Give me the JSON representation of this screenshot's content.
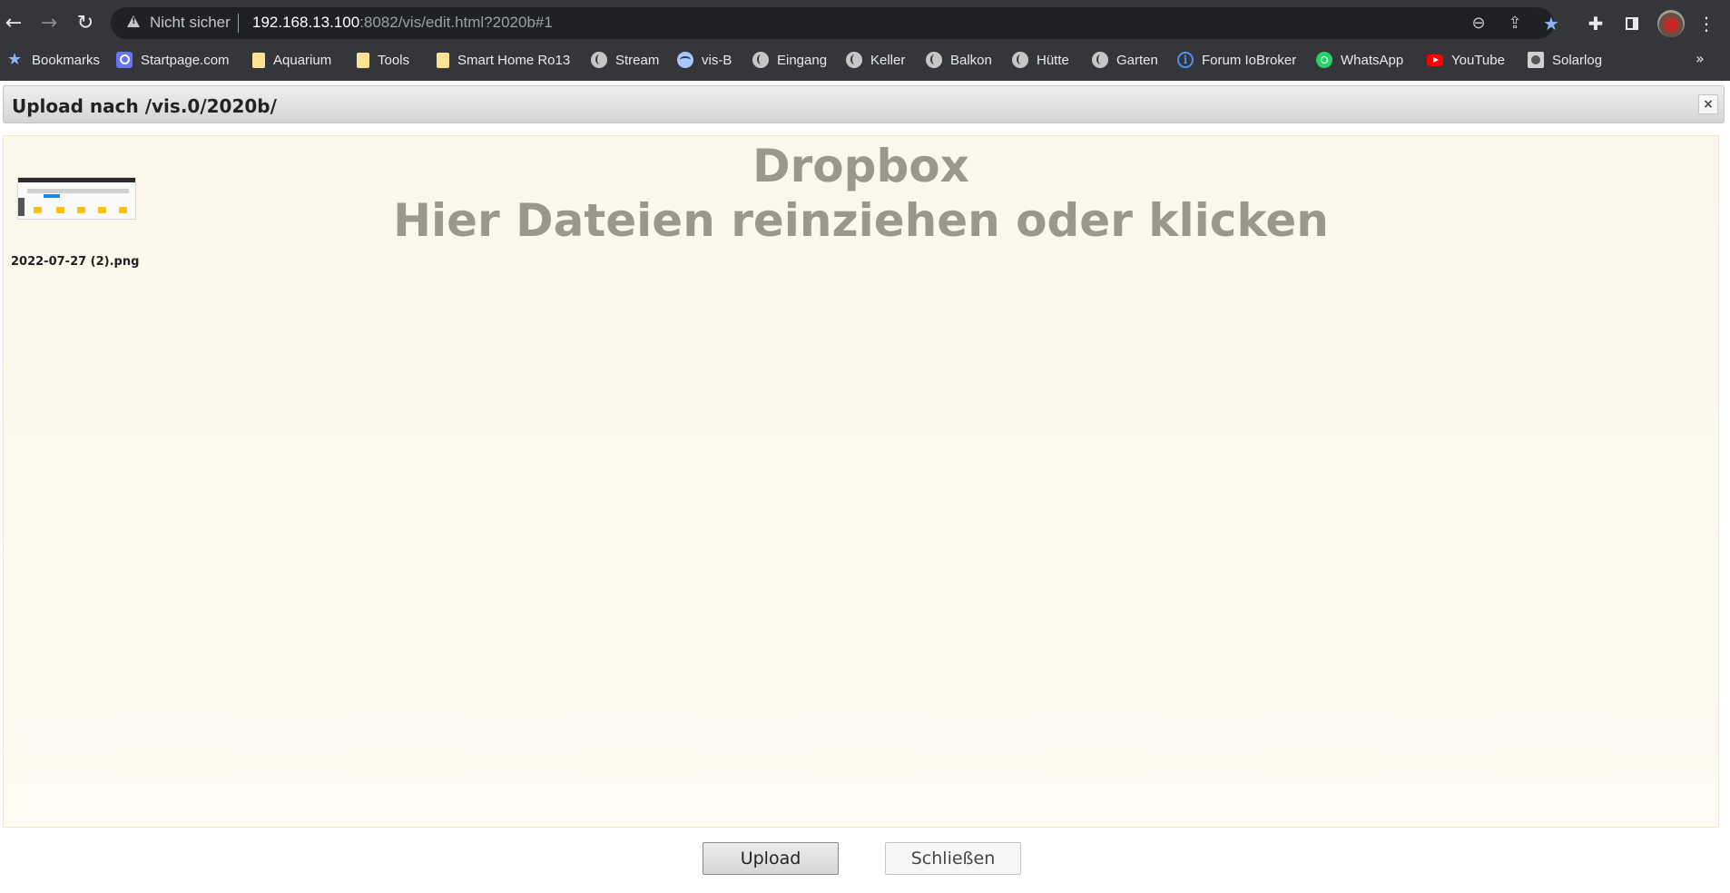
{
  "browser": {
    "security_label": "Nicht sicher",
    "url_host": "192.168.13.100",
    "url_rest": ":8082/vis/edit.html?2020b#1"
  },
  "bookmarks": [
    {
      "label": "Bookmarks",
      "icon": "star-icon"
    },
    {
      "label": "Startpage.com",
      "icon": "startpage-icon"
    },
    {
      "label": "Aquarium",
      "icon": "folder-icon"
    },
    {
      "label": "Tools",
      "icon": "folder-icon"
    },
    {
      "label": "Smart Home Ro13",
      "icon": "folder-icon"
    },
    {
      "label": "Stream",
      "icon": "globe-icon"
    },
    {
      "label": "vis-B",
      "icon": "vis-icon"
    },
    {
      "label": "Eingang",
      "icon": "globe-icon"
    },
    {
      "label": "Keller",
      "icon": "globe-icon"
    },
    {
      "label": "Balkon",
      "icon": "globe-icon"
    },
    {
      "label": "Hütte",
      "icon": "globe-icon"
    },
    {
      "label": "Garten",
      "icon": "globe-icon"
    },
    {
      "label": "Forum IoBroker",
      "icon": "info-icon"
    },
    {
      "label": "WhatsApp",
      "icon": "whatsapp-icon"
    },
    {
      "label": "YouTube",
      "icon": "youtube-icon"
    },
    {
      "label": "Solarlog",
      "icon": "solarlog-icon"
    }
  ],
  "bookmarks_more": "»",
  "dialog": {
    "title": "Upload nach /vis.0/2020b/",
    "close_symbol": "×",
    "dropzone_line1": "Dropbox",
    "dropzone_line2": "Hier Dateien reinziehen oder klicken",
    "files": [
      {
        "name": "2022-07-27 (2).png"
      }
    ],
    "upload_button": "Upload",
    "close_button": "Schließen"
  },
  "colors": {
    "chrome_bg": "#35363a",
    "omnibox_bg": "#202124",
    "dropzone_bg": "#fdf9ee",
    "dropzone_text": "#9b978b"
  }
}
